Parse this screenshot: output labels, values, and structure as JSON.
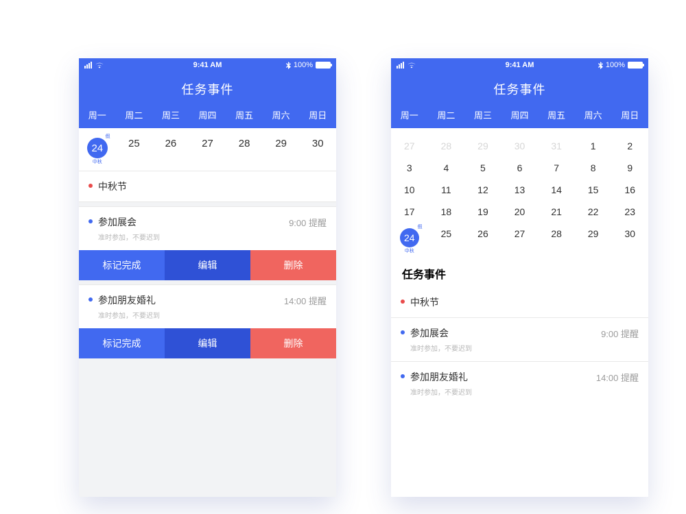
{
  "status": {
    "time": "9:41 AM",
    "battery": "100%"
  },
  "header": {
    "title": "任务事件"
  },
  "weekdays": [
    "周一",
    "周二",
    "周三",
    "周四",
    "周五",
    "周六",
    "周日"
  ],
  "left": {
    "dates": [
      24,
      25,
      26,
      27,
      28,
      29,
      30
    ],
    "selected_index": 0,
    "selected_sup": "假",
    "selected_sub": "中秋",
    "tasks": [
      {
        "dot": "red",
        "title": "中秋节"
      },
      {
        "dot": "blue",
        "title": "参加展会",
        "note": "准时参加，不要迟到",
        "time": "9:00 提醒",
        "actions": true
      },
      {
        "dot": "blue",
        "title": "参加朋友婚礼",
        "note": "准时参加，不要迟到",
        "time": "14:00 提醒",
        "actions": true
      }
    ],
    "actions": {
      "complete": "标记完成",
      "edit": "编辑",
      "delete": "删除"
    }
  },
  "right": {
    "calendar": [
      {
        "cells": [
          {
            "n": 27,
            "prev": true
          },
          {
            "n": 28,
            "prev": true
          },
          {
            "n": 29,
            "prev": true
          },
          {
            "n": 30,
            "prev": true
          },
          {
            "n": 31,
            "prev": true
          },
          {
            "n": 1
          },
          {
            "n": 2
          }
        ]
      },
      {
        "cells": [
          {
            "n": 3
          },
          {
            "n": 4
          },
          {
            "n": 5
          },
          {
            "n": 6
          },
          {
            "n": 7
          },
          {
            "n": 8
          },
          {
            "n": 9
          }
        ]
      },
      {
        "cells": [
          {
            "n": 10
          },
          {
            "n": 11
          },
          {
            "n": 12
          },
          {
            "n": 13
          },
          {
            "n": 14
          },
          {
            "n": 15
          },
          {
            "n": 16
          }
        ]
      },
      {
        "cells": [
          {
            "n": 17
          },
          {
            "n": 18
          },
          {
            "n": 19
          },
          {
            "n": 20
          },
          {
            "n": 21
          },
          {
            "n": 22
          },
          {
            "n": 23
          }
        ]
      },
      {
        "cells": [
          {
            "n": 24,
            "selected": true,
            "sup": "假",
            "sub": "中秋"
          },
          {
            "n": 25
          },
          {
            "n": 26
          },
          {
            "n": 27
          },
          {
            "n": 28
          },
          {
            "n": 29
          },
          {
            "n": 30
          }
        ]
      }
    ],
    "section_title": "任务事件",
    "tasks": [
      {
        "dot": "red",
        "title": "中秋节"
      },
      {
        "dot": "blue",
        "title": "参加展会",
        "note": "准时参加，不要迟到",
        "time": "9:00 提醒"
      },
      {
        "dot": "blue",
        "title": "参加朋友婚礼",
        "note": "准时参加，不要迟到",
        "time": "14:00 提醒"
      }
    ]
  }
}
